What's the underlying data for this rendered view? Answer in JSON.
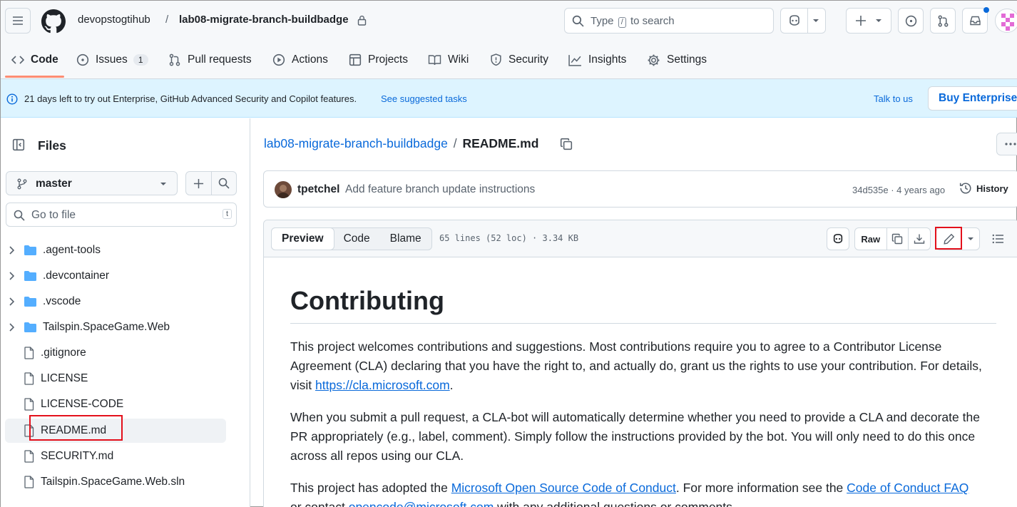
{
  "header": {
    "owner": "devopstogtihub",
    "separator": "/",
    "repo": "lab08-migrate-branch-buildbadge",
    "search_prefix": "Type",
    "search_key": "/",
    "search_suffix": "to search"
  },
  "tabs": [
    {
      "label": "Code",
      "icon": "code-icon"
    },
    {
      "label": "Issues",
      "icon": "issue-icon",
      "count": "1"
    },
    {
      "label": "Pull requests",
      "icon": "pull-request-icon"
    },
    {
      "label": "Actions",
      "icon": "play-icon"
    },
    {
      "label": "Projects",
      "icon": "table-icon"
    },
    {
      "label": "Wiki",
      "icon": "book-icon"
    },
    {
      "label": "Security",
      "icon": "shield-icon"
    },
    {
      "label": "Insights",
      "icon": "graph-icon"
    },
    {
      "label": "Settings",
      "icon": "gear-icon"
    }
  ],
  "banner": {
    "text": "21 days left to try out Enterprise, GitHub Advanced Security and Copilot features.",
    "suggested": "See suggested tasks",
    "talk": "Talk to us",
    "buy": "Buy Enterprise"
  },
  "sidebar": {
    "title": "Files",
    "branch": "master",
    "goto_placeholder": "Go to file",
    "goto_key": "t",
    "items": [
      {
        "name": ".agent-tools",
        "type": "folder"
      },
      {
        "name": ".devcontainer",
        "type": "folder"
      },
      {
        "name": ".vscode",
        "type": "folder"
      },
      {
        "name": "Tailspin.SpaceGame.Web",
        "type": "folder"
      },
      {
        "name": ".gitignore",
        "type": "file"
      },
      {
        "name": "LICENSE",
        "type": "file"
      },
      {
        "name": "LICENSE-CODE",
        "type": "file"
      },
      {
        "name": "README.md",
        "type": "file"
      },
      {
        "name": "SECURITY.md",
        "type": "file"
      },
      {
        "name": "Tailspin.SpaceGame.Web.sln",
        "type": "file"
      }
    ]
  },
  "breadcrumb": {
    "repo": "lab08-migrate-branch-buildbadge",
    "separator": "/",
    "file": "README.md"
  },
  "commit": {
    "author": "tpetchel",
    "message": "Add feature branch update instructions",
    "meta": "34d535e · 4 years ago",
    "history": "History"
  },
  "file_toolbar": {
    "tabs": [
      "Preview",
      "Code",
      "Blame"
    ],
    "info": "65 lines (52 loc) · 3.34 KB",
    "raw": "Raw"
  },
  "readme": {
    "heading": "Contributing",
    "p1_text": "This project welcomes contributions and suggestions. Most contributions require you to agree to a Contributor License Agreement (CLA) declaring that you have the right to, and actually do, grant us the rights to use your contribution. For details, visit ",
    "p1_link": "https://cla.microsoft.com",
    "p1_end": ".",
    "p2_text": "When you submit a pull request, a CLA-bot will automatically determine whether you need to provide a CLA and decorate the PR appropriately (e.g., label, comment). Simply follow the instructions provided by the bot. You will only need to do this once across all repos using our CLA.",
    "p3_text": "This project has adopted the ",
    "p3_link1": "Microsoft Open Source Code of Conduct",
    "p3_mid": ". For more information see the ",
    "p3_link2": "Code of Conduct FAQ",
    "p3_line2_start": "or contact ",
    "p3_email": "opencode@microsoft.com",
    "p3_line2_end": " with any additional questions or comments."
  },
  "colors": {
    "accent_link": "#0969da",
    "highlight_box": "#e3101b",
    "tab_underline": "#fd8c73",
    "banner_bg": "#ddf4ff",
    "folder": "#54aeff"
  }
}
